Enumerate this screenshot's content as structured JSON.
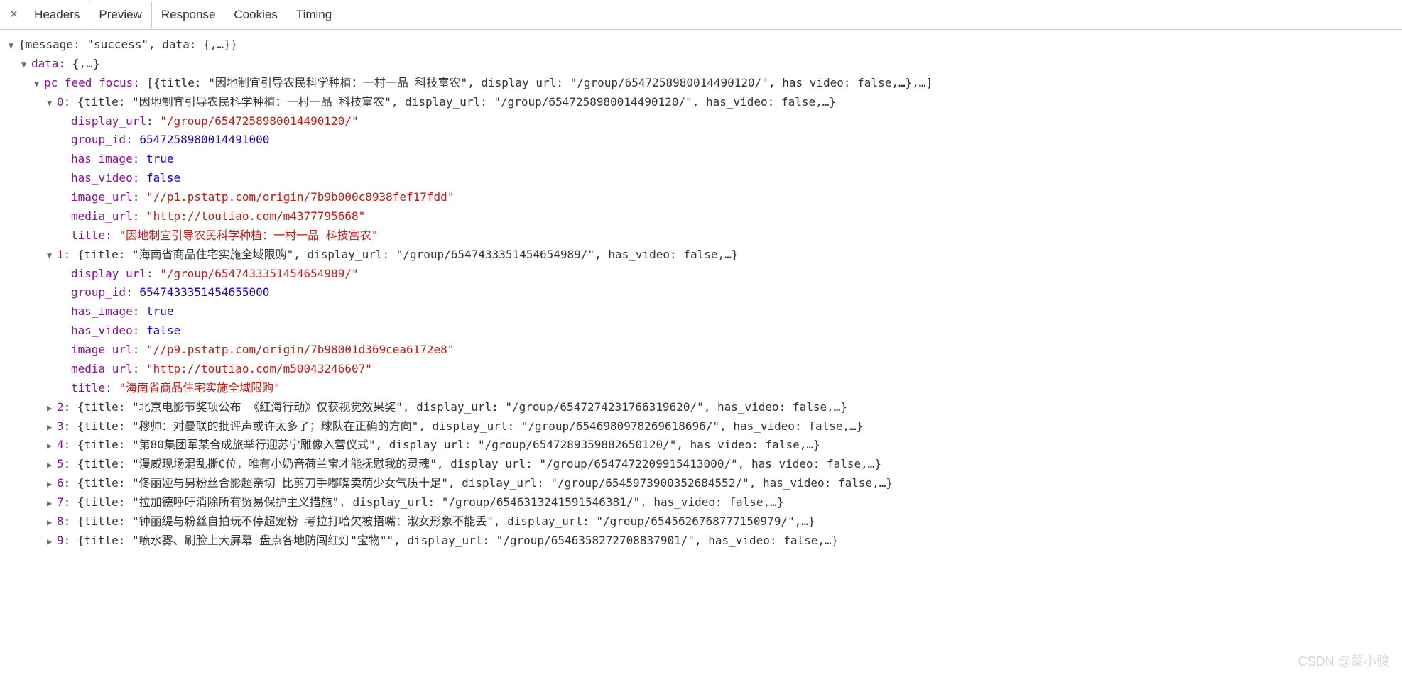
{
  "tabs": {
    "close": "×",
    "headers": "Headers",
    "preview": "Preview",
    "response": "Response",
    "cookies": "Cookies",
    "timing": "Timing"
  },
  "root_summary": "{message: \"success\", data: {,…}}",
  "data_key": "data",
  "data_summary": "{,…}",
  "focus_key": "pc_feed_focus",
  "focus_summary": "[{title: \"因地制宜引导农民科学种植：一村一品 科技富农\", display_url: \"/group/6547258980014490120/\", has_video: false,…},…]",
  "item0": {
    "idx": "0",
    "summary": "{title: \"因地制宜引导农民科学种植：一村一品 科技富农\", display_url: \"/group/6547258980014490120/\", has_video: false,…}",
    "display_url_key": "display_url",
    "display_url": "\"/group/6547258980014490120/\"",
    "group_id_key": "group_id",
    "group_id": "6547258980014491000",
    "has_image_key": "has_image",
    "has_image": "true",
    "has_video_key": "has_video",
    "has_video": "false",
    "image_url_key": "image_url",
    "image_url": "\"//p1.pstatp.com/origin/7b9b000c8938fef17fdd\"",
    "media_url_key": "media_url",
    "media_url": "\"http://toutiao.com/m4377795668\"",
    "title_key": "title",
    "title": "\"因地制宜引导农民科学种植：一村一品 科技富农\""
  },
  "item1": {
    "idx": "1",
    "summary": "{title: \"海南省商品住宅实施全域限购\", display_url: \"/group/6547433351454654989/\", has_video: false,…}",
    "display_url_key": "display_url",
    "display_url": "\"/group/6547433351454654989/\"",
    "group_id_key": "group_id",
    "group_id": "6547433351454655000",
    "has_image_key": "has_image",
    "has_image": "true",
    "has_video_key": "has_video",
    "has_video": "false",
    "image_url_key": "image_url",
    "image_url": "\"//p9.pstatp.com/origin/7b98001d369cea6172e8\"",
    "media_url_key": "media_url",
    "media_url": "\"http://toutiao.com/m50043246607\"",
    "title_key": "title",
    "title": "\"海南省商品住宅实施全域限购\""
  },
  "collapsed": [
    {
      "idx": "2",
      "summary": "{title: \"北京电影节奖项公布 《红海行动》仅获视觉效果奖\", display_url: \"/group/6547274231766319620/\", has_video: false,…}"
    },
    {
      "idx": "3",
      "summary": "{title: \"穆帅：对曼联的批评声或许太多了；球队在正确的方向\", display_url: \"/group/6546980978269618696/\", has_video: false,…}"
    },
    {
      "idx": "4",
      "summary": "{title: \"第80集团军某合成旅举行迎苏宁雕像入营仪式\", display_url: \"/group/6547289359882650120/\", has_video: false,…}"
    },
    {
      "idx": "5",
      "summary": "{title: \"漫威现场混乱撕C位，唯有小奶音荷兰宝才能抚慰我的灵魂\", display_url: \"/group/6547472209915413000/\", has_video: false,…}"
    },
    {
      "idx": "6",
      "summary": "{title: \"佟丽娅与男粉丝合影超亲切 比剪刀手嘟嘴卖萌少女气质十足\", display_url: \"/group/6545973900352684552/\", has_video: false,…}"
    },
    {
      "idx": "7",
      "summary": "{title: \"拉加德呼吁消除所有贸易保护主义措施\", display_url: \"/group/6546313241591546381/\", has_video: false,…}"
    },
    {
      "idx": "8",
      "summary": "{title: \"钟丽缇与粉丝自拍玩不停超宠粉 考拉打哈欠被捂嘴：淑女形象不能丢\", display_url: \"/group/6545626768777150979/\",…}"
    },
    {
      "idx": "9",
      "summary": "{title: \"喷水雾、刷脸上大屏幕 盘点各地防闯红灯\"宝物\"\", display_url: \"/group/6546358272708837901/\", has_video: false,…}"
    }
  ],
  "watermark": "CSDN @蒙小骏"
}
